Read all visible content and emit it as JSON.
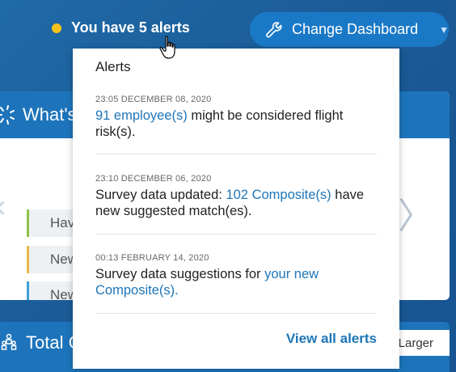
{
  "header": {
    "alerts_label": "You have 5 alerts",
    "change_dashboard_label": "Change Dashboard",
    "caret": "▼"
  },
  "cards": {
    "top_title_partial": "What's",
    "news_items": [
      "Hav",
      "New",
      "New"
    ],
    "bottom_title_partial": "Total C",
    "bottom_button_partial": "Larger"
  },
  "alerts_panel": {
    "title": "Alerts",
    "items": [
      {
        "timestamp": "23:05 DECEMBER 08, 2020",
        "link": "91 employee(s)",
        "text_after": " might be considered flight risk(s)."
      },
      {
        "timestamp": "23:10 DECEMBER 06, 2020",
        "text_before": "Survey data updated: ",
        "link": "102 Composite(s)",
        "text_after": " have new suggested match(es)."
      },
      {
        "timestamp": "00:13 FEBRUARY 14, 2020",
        "text_before": "Survey data suggestions for ",
        "link": "your new Composite(s)."
      }
    ],
    "view_all_label": "View all alerts"
  },
  "colors": {
    "background": "#1a5f9e",
    "accent_button": "#1a79c6",
    "alert_dot": "#f5c21b",
    "link": "#1d75b8"
  }
}
